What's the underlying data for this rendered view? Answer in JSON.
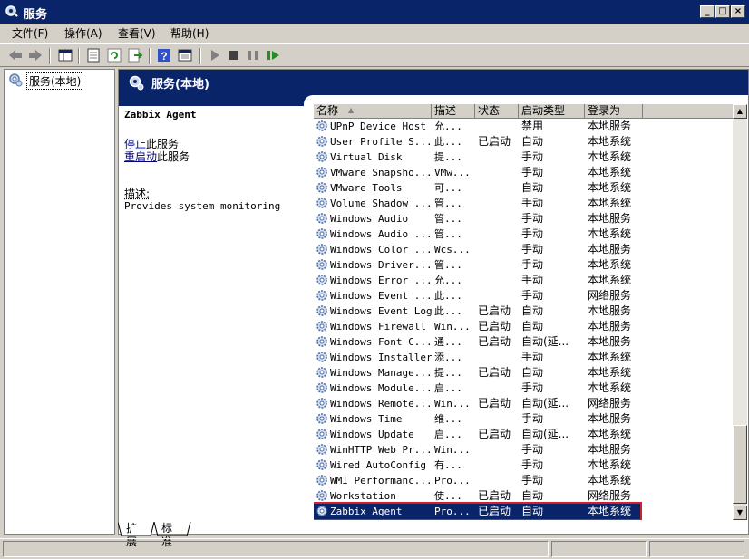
{
  "window": {
    "title": "服务"
  },
  "menu": [
    {
      "label": "文件(F)"
    },
    {
      "label": "操作(A)"
    },
    {
      "label": "查看(V)"
    },
    {
      "label": "帮助(H)"
    }
  ],
  "tree": {
    "root_label": "服务(本地)"
  },
  "panel": {
    "header": "服务(本地)",
    "selected_service": "Zabbix Agent",
    "stop_link": "停止",
    "stop_suffix": "此服务",
    "restart_link": "重启动",
    "restart_suffix": "此服务",
    "desc_label": "描述:",
    "desc_text": "Provides system monitoring"
  },
  "columns": [
    {
      "label": "名称"
    },
    {
      "label": "描述"
    },
    {
      "label": "状态"
    },
    {
      "label": "启动类型"
    },
    {
      "label": "登录为"
    }
  ],
  "services": [
    {
      "name": "UPnP Device Host",
      "desc": "允...",
      "status": "",
      "startup": "禁用",
      "logon": "本地服务"
    },
    {
      "name": "User Profile S...",
      "desc": "此...",
      "status": "已启动",
      "startup": "自动",
      "logon": "本地系统"
    },
    {
      "name": "Virtual Disk",
      "desc": "提...",
      "status": "",
      "startup": "手动",
      "logon": "本地系统"
    },
    {
      "name": "VMware Snapsho...",
      "desc": "VMw...",
      "status": "",
      "startup": "手动",
      "logon": "本地系统"
    },
    {
      "name": "VMware Tools",
      "desc": "可...",
      "status": "",
      "startup": "自动",
      "logon": "本地系统"
    },
    {
      "name": "Volume Shadow ...",
      "desc": "管...",
      "status": "",
      "startup": "手动",
      "logon": "本地系统"
    },
    {
      "name": "Windows Audio",
      "desc": "管...",
      "status": "",
      "startup": "手动",
      "logon": "本地服务"
    },
    {
      "name": "Windows Audio ...",
      "desc": "管...",
      "status": "",
      "startup": "手动",
      "logon": "本地系统"
    },
    {
      "name": "Windows Color ...",
      "desc": "Wcs...",
      "status": "",
      "startup": "手动",
      "logon": "本地服务"
    },
    {
      "name": "Windows Driver...",
      "desc": "管...",
      "status": "",
      "startup": "手动",
      "logon": "本地系统"
    },
    {
      "name": "Windows Error ...",
      "desc": "允...",
      "status": "",
      "startup": "手动",
      "logon": "本地系统"
    },
    {
      "name": "Windows Event ...",
      "desc": "此...",
      "status": "",
      "startup": "手动",
      "logon": "网络服务"
    },
    {
      "name": "Windows Event Log",
      "desc": "此...",
      "status": "已启动",
      "startup": "自动",
      "logon": "本地服务"
    },
    {
      "name": "Windows Firewall",
      "desc": "Win...",
      "status": "已启动",
      "startup": "自动",
      "logon": "本地服务"
    },
    {
      "name": "Windows Font C...",
      "desc": "通...",
      "status": "已启动",
      "startup": "自动(延...",
      "logon": "本地服务"
    },
    {
      "name": "Windows Installer",
      "desc": "添...",
      "status": "",
      "startup": "手动",
      "logon": "本地系统"
    },
    {
      "name": "Windows Manage...",
      "desc": "提...",
      "status": "已启动",
      "startup": "自动",
      "logon": "本地系统"
    },
    {
      "name": "Windows Module...",
      "desc": "启...",
      "status": "",
      "startup": "手动",
      "logon": "本地系统"
    },
    {
      "name": "Windows Remote...",
      "desc": "Win...",
      "status": "已启动",
      "startup": "自动(延...",
      "logon": "网络服务"
    },
    {
      "name": "Windows Time",
      "desc": "维...",
      "status": "",
      "startup": "手动",
      "logon": "本地服务"
    },
    {
      "name": "Windows Update",
      "desc": "启...",
      "status": "已启动",
      "startup": "自动(延...",
      "logon": "本地系统"
    },
    {
      "name": "WinHTTP Web Pr...",
      "desc": "Win...",
      "status": "",
      "startup": "手动",
      "logon": "本地服务"
    },
    {
      "name": "Wired AutoConfig",
      "desc": "有...",
      "status": "",
      "startup": "手动",
      "logon": "本地系统"
    },
    {
      "name": "WMI Performanc...",
      "desc": "Pro...",
      "status": "",
      "startup": "手动",
      "logon": "本地系统"
    },
    {
      "name": "Workstation",
      "desc": "使...",
      "status": "已启动",
      "startup": "自动",
      "logon": "网络服务"
    },
    {
      "name": "Zabbix Agent",
      "desc": "Pro...",
      "status": "已启动",
      "startup": "自动",
      "logon": "本地系统",
      "selected": true
    }
  ],
  "tabs": [
    {
      "label": "扩展"
    },
    {
      "label": "标准"
    }
  ],
  "colors": {
    "titlebar": "#0a246a",
    "selection": "#0a246a",
    "highlight_border": "#d0202a"
  }
}
